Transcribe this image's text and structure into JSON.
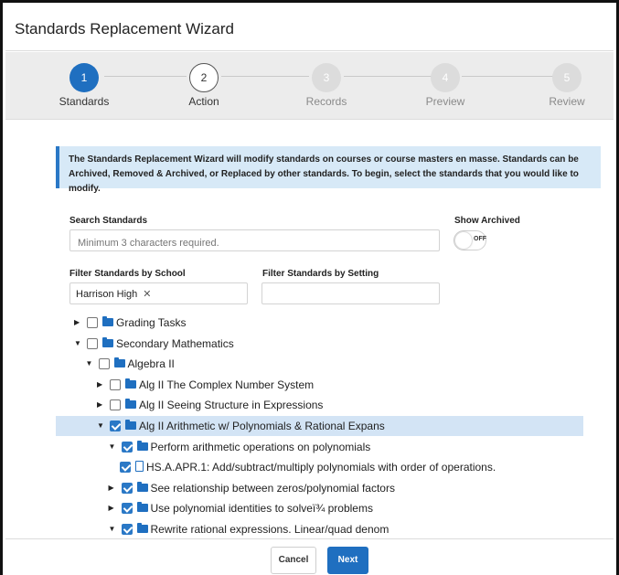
{
  "window": {
    "title": "Standards Replacement Wizard"
  },
  "stepper": {
    "steps": [
      {
        "number": "1",
        "label": "Standards",
        "state": "active"
      },
      {
        "number": "2",
        "label": "Action",
        "state": "next"
      },
      {
        "number": "3",
        "label": "Records",
        "state": "future"
      },
      {
        "number": "4",
        "label": "Preview",
        "state": "future"
      },
      {
        "number": "5",
        "label": "Review",
        "state": "future"
      }
    ]
  },
  "info": {
    "text": "The Standards Replacement Wizard will modify standards on courses or course masters en masse. Standards can be Archived, Removed & Archived, or Replaced by other standards. To begin, select the standards that you would like to modify."
  },
  "search": {
    "label": "Search Standards",
    "placeholder": "Minimum 3 characters required."
  },
  "show_archived": {
    "label": "Show Archived",
    "state_text": "OFF"
  },
  "filter_school": {
    "label": "Filter Standards by School",
    "chip": "Harrison High",
    "remove_glyph": "✕"
  },
  "filter_setting": {
    "label": "Filter Standards by Setting",
    "value": ""
  },
  "tree": [
    {
      "label": "Grading Tasks",
      "expanded": false,
      "checked": false,
      "level": 0,
      "type": "folder",
      "selected": false
    },
    {
      "label": "Secondary Mathematics",
      "expanded": true,
      "checked": false,
      "level": 0,
      "type": "folder",
      "selected": false
    },
    {
      "label": "Algebra II",
      "expanded": true,
      "checked": false,
      "level": 1,
      "type": "folder",
      "selected": false
    },
    {
      "label": "Alg II The Complex Number System",
      "expanded": false,
      "checked": false,
      "level": 2,
      "type": "folder",
      "selected": false
    },
    {
      "label": "Alg II Seeing Structure in Expressions",
      "expanded": false,
      "checked": false,
      "level": 2,
      "type": "folder",
      "selected": false
    },
    {
      "label": "Alg II Arithmetic w/ Polynomials & Rational Expans",
      "expanded": true,
      "checked": true,
      "level": 2,
      "type": "folder",
      "selected": true
    },
    {
      "label": "Perform arithmetic operations on polynomials",
      "expanded": true,
      "checked": true,
      "level": 3,
      "type": "folder",
      "selected": false
    },
    {
      "label": "HS.A.APR.1: Add/subtract/multiply polynomials with order of operations.",
      "expanded": null,
      "checked": true,
      "level": 4,
      "type": "document",
      "selected": false
    },
    {
      "label": "See relationship between zeros/polynomial factors",
      "expanded": false,
      "checked": true,
      "level": 3,
      "type": "folder",
      "selected": false
    },
    {
      "label": "Use polynomial identities to solveï¾ problems",
      "expanded": false,
      "checked": true,
      "level": 3,
      "type": "folder",
      "selected": false
    },
    {
      "label": "Rewrite rational expressions. Linear/quad denom",
      "expanded": true,
      "checked": true,
      "level": 3,
      "type": "folder",
      "selected": false
    }
  ],
  "footer": {
    "cancel_label": "Cancel",
    "next_label": "Next"
  },
  "colors": {
    "accent": "#1f6fc0",
    "info_bg": "#d7e9f7",
    "selected_row": "#d3e4f5",
    "stepper_bg": "#ececec"
  }
}
